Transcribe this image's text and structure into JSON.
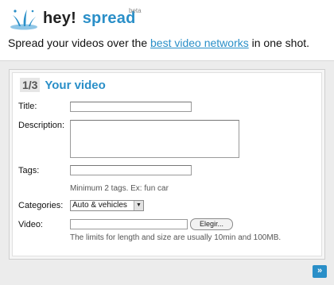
{
  "header": {
    "brand_hey": "hey!",
    "brand_spread": "spread",
    "beta": "beta",
    "tagline_before": "Spread your videos over the ",
    "tagline_link": "best video networks",
    "tagline_after": " in one shot."
  },
  "form": {
    "step_number": "1/3",
    "step_title": "Your video",
    "title_label": "Title:",
    "title_value": "",
    "description_label": "Description:",
    "description_value": "",
    "tags_label": "Tags:",
    "tags_value": "",
    "tags_hint": "Minimum 2 tags. Ex: fun car",
    "categories_label": "Categories:",
    "categories_selected": "Auto & vehicles",
    "video_label": "Video:",
    "file_button_label": "Elegir...",
    "video_hint": "The limits for length and size are usually 10min and 100MB."
  },
  "nav": {
    "next_label": "»"
  },
  "icons": {
    "logo": "splash-icon",
    "select_arrow": "triangle-down-icon",
    "scroll_up": "triangle-up-icon",
    "scroll_down": "triangle-down-icon"
  },
  "colors": {
    "accent": "#2a8fc8",
    "background_gray": "#ececec"
  }
}
